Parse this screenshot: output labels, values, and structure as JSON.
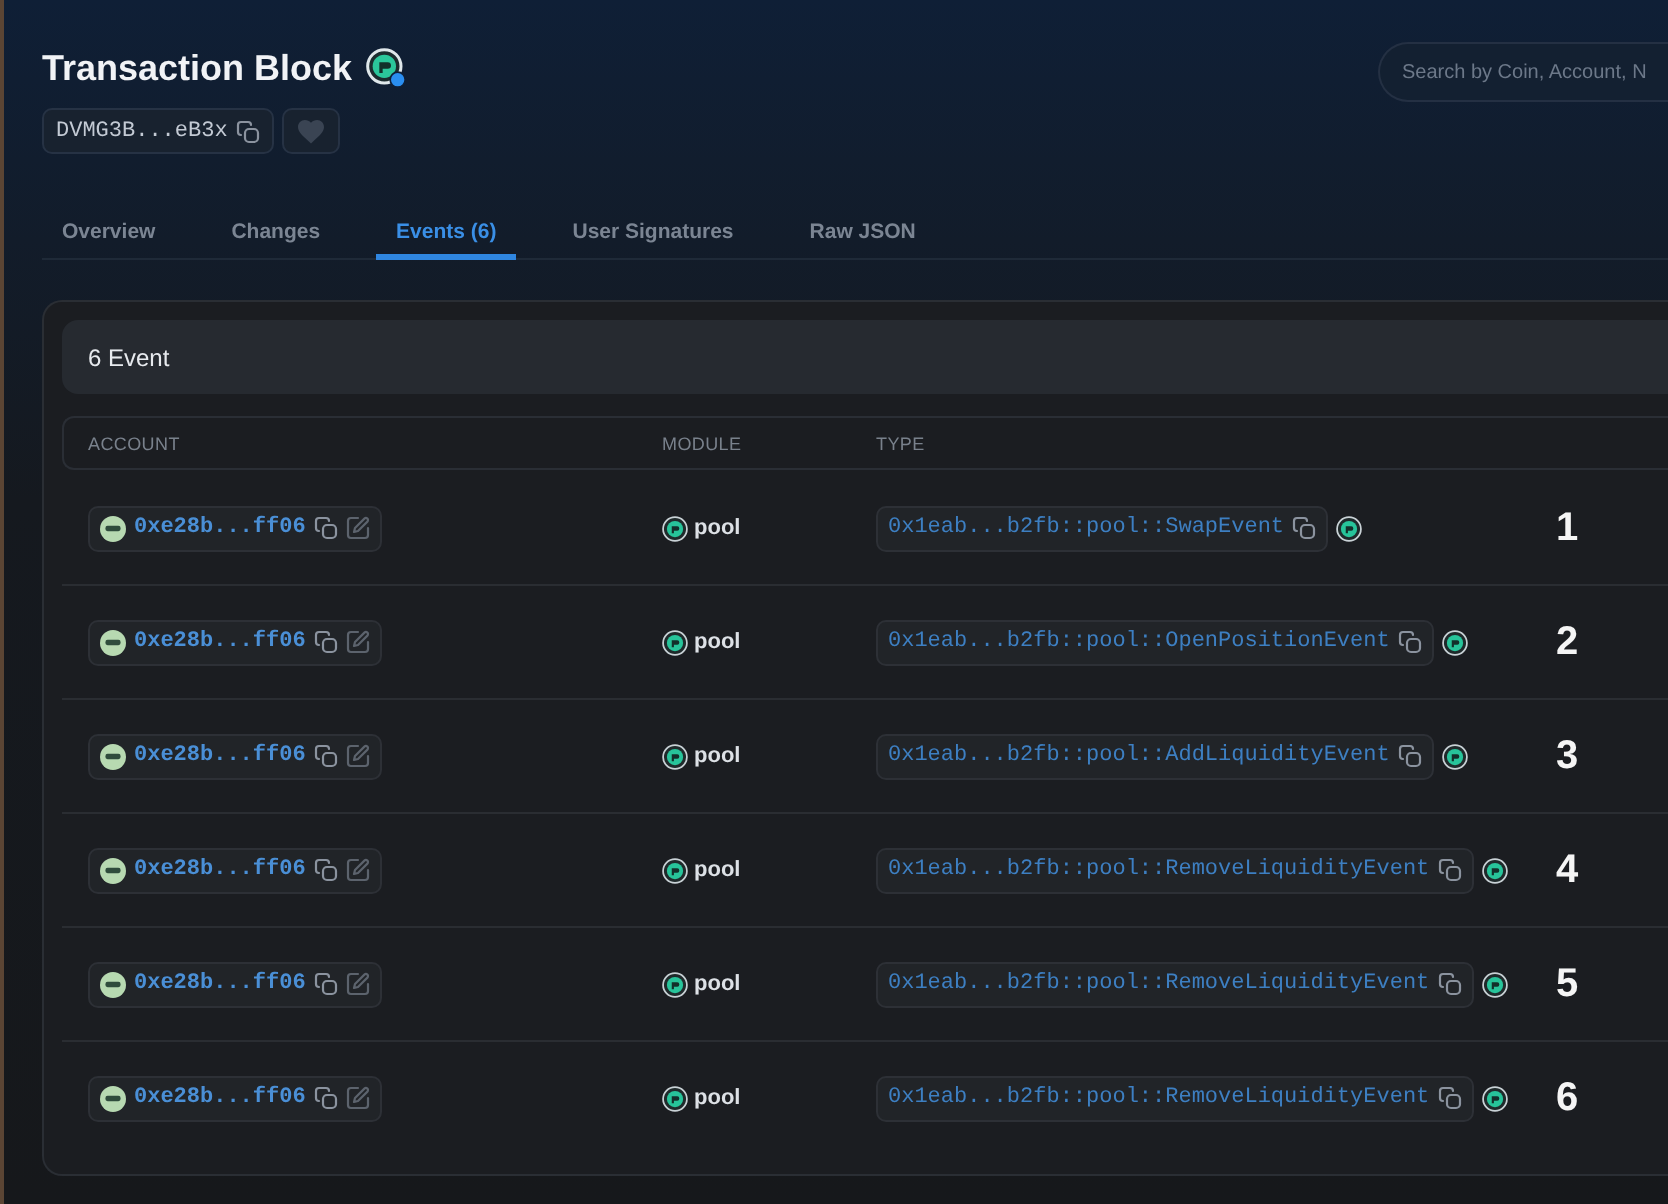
{
  "header": {
    "title": "Transaction Block",
    "digest": "DVMG3B...eB3x",
    "favorited": false
  },
  "search": {
    "placeholder": "Search by Coin, Account, N"
  },
  "tabs": [
    {
      "label": "Overview",
      "selected": false
    },
    {
      "label": "Changes",
      "selected": false
    },
    {
      "label": "Events (6)",
      "selected": true
    },
    {
      "label": "User Signatures",
      "selected": false
    },
    {
      "label": "Raw JSON",
      "selected": false
    }
  ],
  "events_panel": {
    "title": "6 Event",
    "columns": [
      "ACCOUNT",
      "MODULE",
      "TYPE"
    ],
    "rows": [
      {
        "account": "0xe28b...ff06",
        "module": "pool",
        "type": "0x1eab...b2fb::pool::SwapEvent",
        "annotation": "1"
      },
      {
        "account": "0xe28b...ff06",
        "module": "pool",
        "type": "0x1eab...b2fb::pool::OpenPositionEvent",
        "annotation": "2"
      },
      {
        "account": "0xe28b...ff06",
        "module": "pool",
        "type": "0x1eab...b2fb::pool::AddLiquidityEvent",
        "annotation": "3"
      },
      {
        "account": "0xe28b...ff06",
        "module": "pool",
        "type": "0x1eab...b2fb::pool::RemoveLiquidityEvent",
        "annotation": "4"
      },
      {
        "account": "0xe28b...ff06",
        "module": "pool",
        "type": "0x1eab...b2fb::pool::RemoveLiquidityEvent",
        "annotation": "5"
      },
      {
        "account": "0xe28b...ff06",
        "module": "pool",
        "type": "0x1eab...b2fb::pool::RemoveLiquidityEvent",
        "annotation": "6"
      }
    ]
  }
}
